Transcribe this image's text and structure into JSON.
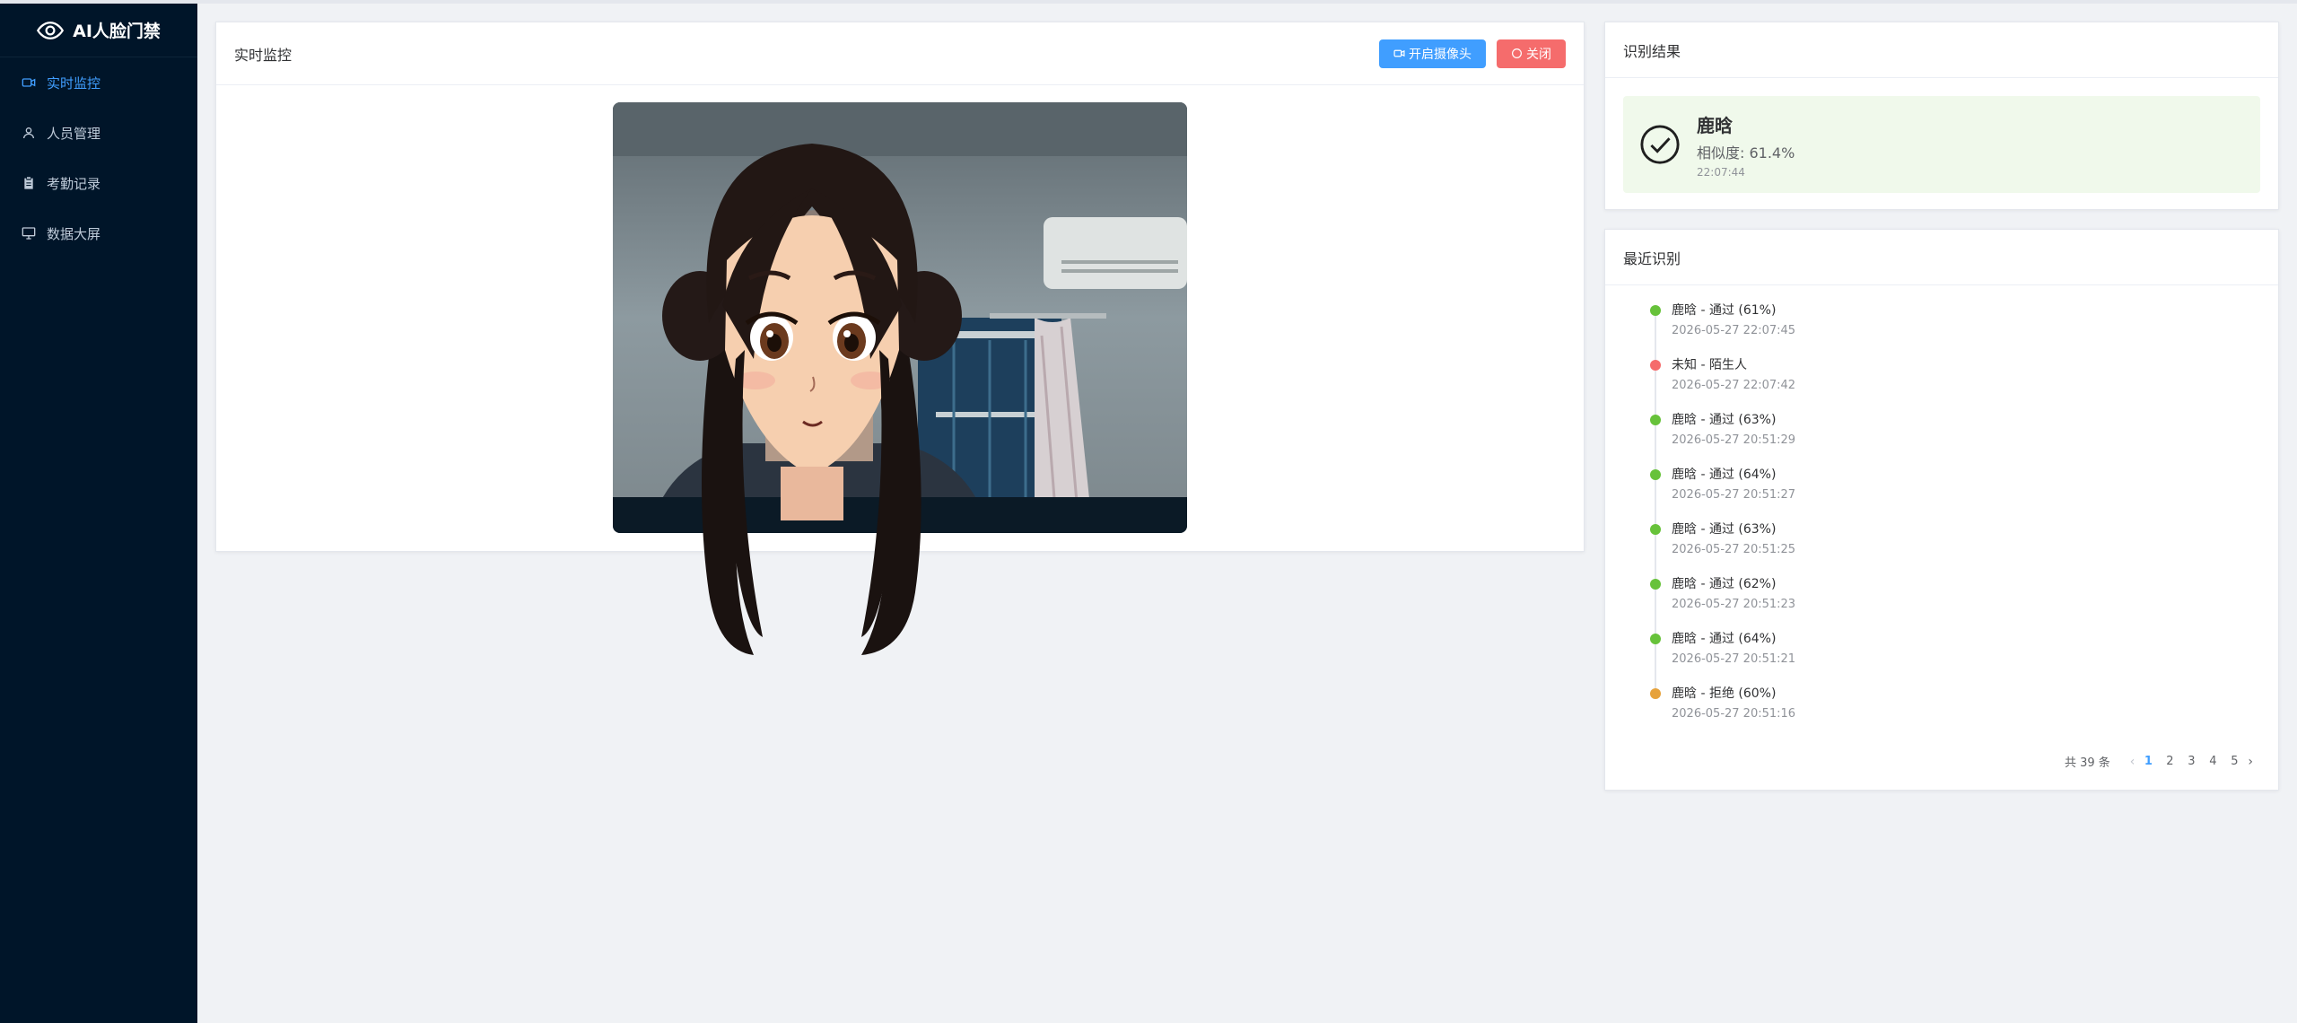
{
  "app": {
    "title": "AI人脸门禁",
    "logo_icon": "eye-icon"
  },
  "sidebar": {
    "items": [
      {
        "label": "实时监控",
        "icon": "video-camera-icon",
        "active": true
      },
      {
        "label": "人员管理",
        "icon": "user-icon",
        "active": false
      },
      {
        "label": "考勤记录",
        "icon": "clipboard-icon",
        "active": false
      },
      {
        "label": "数据大屏",
        "icon": "monitor-icon",
        "active": false
      }
    ]
  },
  "monitor": {
    "title": "实时监控",
    "open_camera_label": "开启摄像头",
    "close_label": "关闭"
  },
  "result": {
    "title": "识别结果",
    "name": "鹿晗",
    "similarity": "相似度: 61.4%",
    "time": "22:07:44",
    "status_color": "#f0f9eb"
  },
  "recent": {
    "title": "最近识别",
    "items": [
      {
        "title": "鹿晗 - 通过 (61%)",
        "time": "2026-05-27 22:07:45",
        "color": "#67c23a"
      },
      {
        "title": "未知 - 陌生人",
        "time": "2026-05-27 22:07:42",
        "color": "#f56c6c"
      },
      {
        "title": "鹿晗 - 通过 (63%)",
        "time": "2026-05-27 20:51:29",
        "color": "#67c23a"
      },
      {
        "title": "鹿晗 - 通过 (64%)",
        "time": "2026-05-27 20:51:27",
        "color": "#67c23a"
      },
      {
        "title": "鹿晗 - 通过 (63%)",
        "time": "2026-05-27 20:51:25",
        "color": "#67c23a"
      },
      {
        "title": "鹿晗 - 通过 (62%)",
        "time": "2026-05-27 20:51:23",
        "color": "#67c23a"
      },
      {
        "title": "鹿晗 - 通过 (64%)",
        "time": "2026-05-27 20:51:21",
        "color": "#67c23a"
      },
      {
        "title": "鹿晗 - 拒绝 (60%)",
        "time": "2026-05-27 20:51:16",
        "color": "#e6a23c"
      }
    ],
    "pagination": {
      "total_text": "共 39 条",
      "pages": [
        "1",
        "2",
        "3",
        "4",
        "5"
      ],
      "current": "1"
    }
  },
  "colors": {
    "accent": "#409eff",
    "danger": "#f56c6c",
    "success": "#67c23a",
    "warning": "#e6a23c",
    "sidebar_bg": "#001529"
  }
}
